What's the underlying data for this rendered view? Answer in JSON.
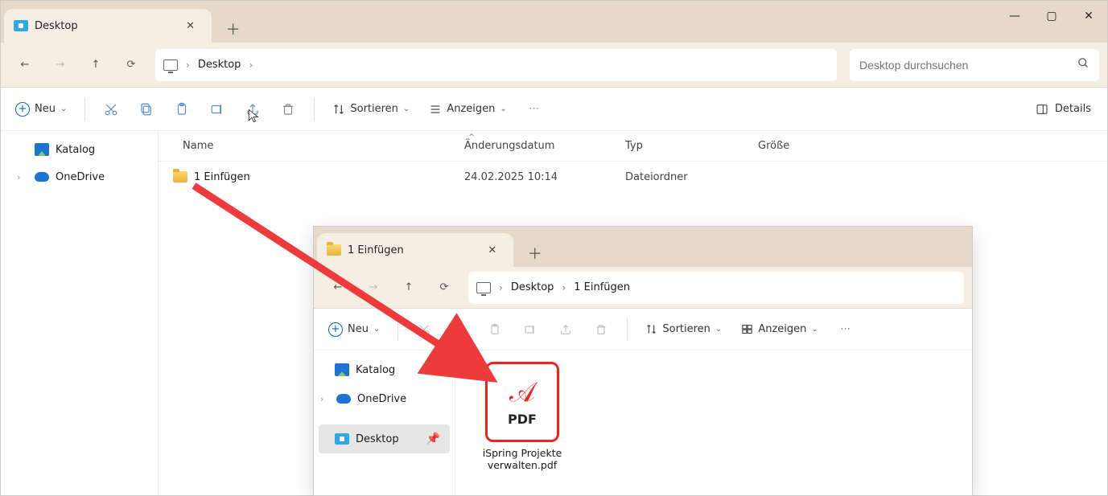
{
  "window1": {
    "tab_label": "Desktop",
    "minimize": "—",
    "maximize": "▢",
    "close": "✕",
    "breadcrumb": [
      "Desktop"
    ],
    "search_placeholder": "Desktop durchsuchen",
    "new_label": "Neu",
    "sort_label": "Sortieren",
    "view_label": "Anzeigen",
    "details_label": "Details",
    "columns": {
      "name": "Name",
      "date": "Änderungsdatum",
      "type": "Typ",
      "size": "Größe"
    },
    "nav": [
      {
        "label": "Katalog",
        "icon": "katalog"
      },
      {
        "label": "OneDrive",
        "icon": "onedrive",
        "expandable": true
      }
    ],
    "row": {
      "name": "1 Einfügen",
      "date": "24.02.2025 10:14",
      "type": "Dateiordner"
    }
  },
  "window2": {
    "tab_label": "1 Einfügen",
    "breadcrumb": [
      "Desktop",
      "1 Einfügen"
    ],
    "new_label": "Neu",
    "sort_label": "Sortieren",
    "view_label": "Anzeigen",
    "nav": [
      {
        "label": "Katalog",
        "icon": "katalog"
      },
      {
        "label": "OneDrive",
        "icon": "onedrive",
        "expandable": true
      },
      {
        "label": "Desktop",
        "icon": "desktop",
        "selected": true,
        "pinned": true
      }
    ],
    "file": {
      "label": "iSpring Projekte verwalten.pdf",
      "badge": "PDF"
    }
  }
}
